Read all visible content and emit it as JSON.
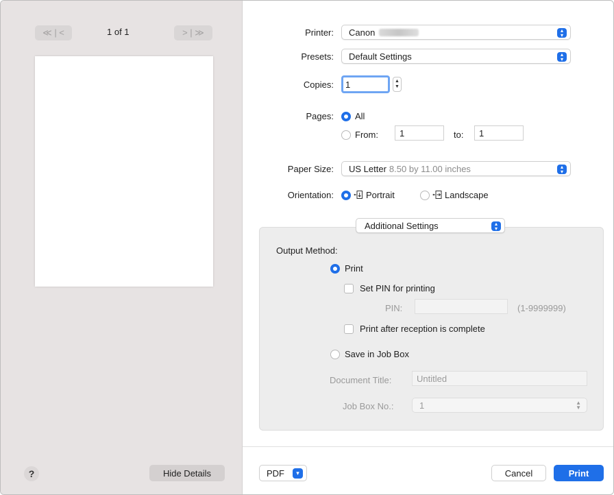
{
  "preview": {
    "prev_label": "≪ | <",
    "next_label": "> | ≫",
    "page_count": "1 of 1",
    "help_label": "?",
    "hide_details_label": "Hide Details"
  },
  "printer": {
    "label": "Printer:",
    "value": "Canon"
  },
  "presets": {
    "label": "Presets:",
    "value": "Default Settings"
  },
  "copies": {
    "label": "Copies:",
    "value": "1"
  },
  "pages": {
    "label": "Pages:",
    "all_label": "All",
    "from_label": "From:",
    "from_value": "1",
    "to_label": "to:",
    "to_value": "1",
    "selected": "All"
  },
  "paper_size": {
    "label": "Paper Size:",
    "value": "US Letter",
    "detail": "8.50 by 11.00 inches"
  },
  "orientation": {
    "label": "Orientation:",
    "portrait_label": "Portrait",
    "landscape_label": "Landscape",
    "selected": "Portrait"
  },
  "section_popup": {
    "value": "Additional Settings"
  },
  "output": {
    "heading": "Output Method:",
    "print_label": "Print",
    "set_pin_label": "Set PIN for printing",
    "pin_label": "PIN:",
    "pin_value": "",
    "pin_range": "(1-9999999)",
    "after_reception_label": "Print after reception is complete",
    "save_job_box_label": "Save in Job Box",
    "doc_title_label": "Document Title:",
    "doc_title_value": "Untitled",
    "job_box_label": "Job Box No.:",
    "job_box_value": "1",
    "selected": "Print"
  },
  "footer": {
    "pdf_label": "PDF",
    "cancel_label": "Cancel",
    "print_label": "Print"
  },
  "colors": {
    "accent": "#1f6fe8",
    "sidebar_bg": "#e7e3e3",
    "group_bg": "#ededed"
  },
  "icons": [
    "chevron-popup-icon",
    "stepper-icon",
    "portrait-orientation-icon",
    "landscape-orientation-icon",
    "help-icon",
    "chevron-down-icon"
  ]
}
